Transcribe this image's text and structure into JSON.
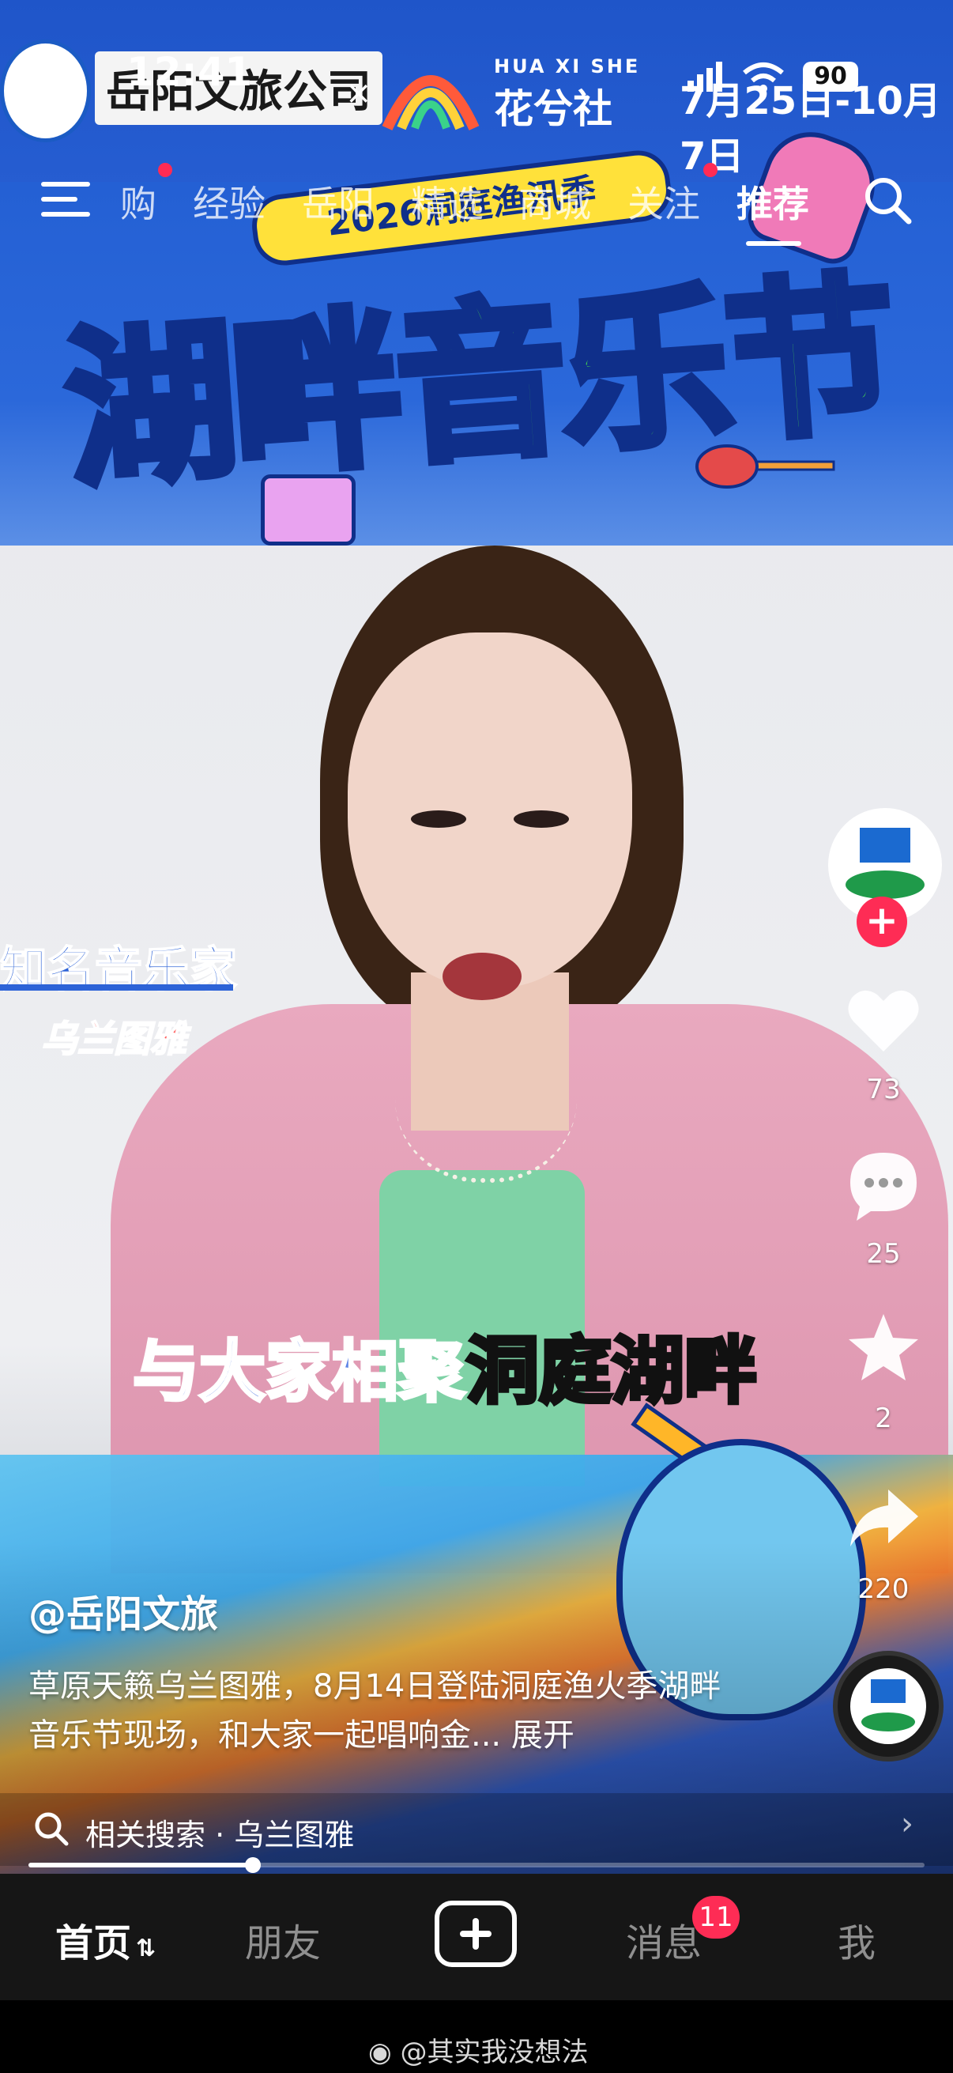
{
  "status_bar": {
    "time": "12:41",
    "battery": "90",
    "date_range": "7月25日-10月7日"
  },
  "brand_overlay": {
    "left_logo_text": "岳阳文旅公司",
    "times": "×",
    "partner_en": "HUA XI SHE",
    "partner_cn": "花兮社"
  },
  "top_nav": {
    "items": [
      {
        "label": "购",
        "dot": true
      },
      {
        "label": "经验",
        "dot": false
      },
      {
        "label": "岳阳",
        "dot": false
      },
      {
        "label": "精选",
        "dot": false
      },
      {
        "label": "商城",
        "dot": false
      },
      {
        "label": "关注",
        "dot": true
      },
      {
        "label": "推荐",
        "dot": false,
        "active": true
      }
    ]
  },
  "video": {
    "banner_ribbon": "2026洞庭渔汛季",
    "banner_title": "湖畔音乐节",
    "caption_title": "知名音乐家",
    "caption_name": "乌兰图雅",
    "subtitle_blue": "与大家相聚",
    "subtitle_yellow": "洞庭湖畔"
  },
  "right_rail": {
    "likes": "73",
    "comments": "25",
    "favorites": "2",
    "shares": "220"
  },
  "post": {
    "author": "@岳阳文旅",
    "description": "草原天籁乌兰图雅，8月14日登陆洞庭渔火季湖畔音乐节现场，和大家一起唱响金... 展开",
    "related_search": "相关搜索 · 乌兰图雅",
    "progress": 0.25
  },
  "tab_bar": {
    "home": "首页",
    "friends": "朋友",
    "messages": "消息",
    "messages_badge": "11",
    "me": "我"
  },
  "watermark": "@其实我没想法",
  "colors": {
    "accent_red": "#fe2c55",
    "banner_green": "#46e04a",
    "banner_blue": "#2460d4"
  }
}
